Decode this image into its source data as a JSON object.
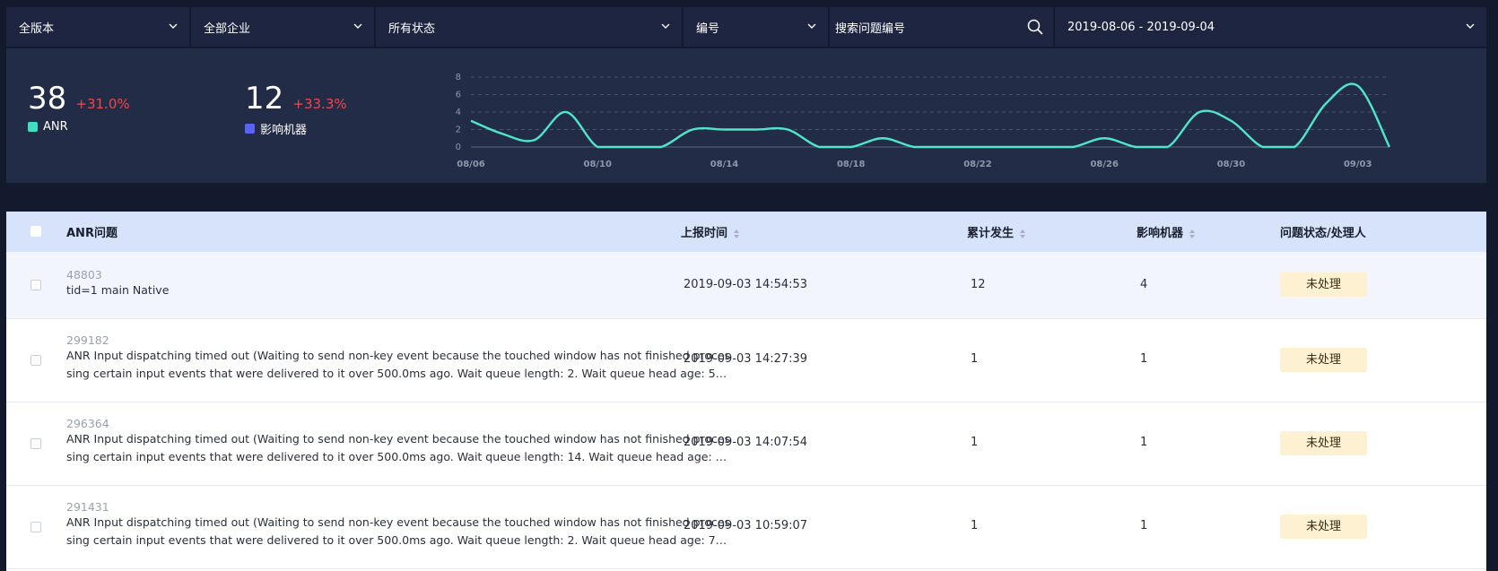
{
  "filters": {
    "version": "全版本",
    "company": "全部企业",
    "status": "所有状态",
    "id_type": "编号",
    "search_placeholder": "搜索问题编号",
    "date_range": "2019-08-06 - 2019-09-04"
  },
  "stats": {
    "anr": {
      "value": "38",
      "change": "+31.0%",
      "label": "ANR",
      "color": "#3de0c0"
    },
    "devices": {
      "value": "12",
      "change": "+33.3%",
      "label": "影响机器",
      "color": "#5b63f5"
    }
  },
  "colors": {
    "accent": "#4fe6c8",
    "negative": "#f0474b",
    "header_bg": "#d6e3fb",
    "badge_bg": "#fdf1d2"
  },
  "chart_data": {
    "type": "line",
    "x": [
      "08/06",
      "08/07",
      "08/08",
      "08/09",
      "08/10",
      "08/11",
      "08/12",
      "08/13",
      "08/14",
      "08/15",
      "08/16",
      "08/17",
      "08/18",
      "08/19",
      "08/20",
      "08/21",
      "08/22",
      "08/23",
      "08/24",
      "08/25",
      "08/26",
      "08/27",
      "08/28",
      "08/29",
      "08/30",
      "08/31",
      "09/01",
      "09/02",
      "09/03",
      "09/04"
    ],
    "series": [
      {
        "values": [
          3,
          1.5,
          0.8,
          4,
          0,
          0,
          0,
          2,
          2,
          2,
          2,
          0,
          0,
          1,
          0,
          0,
          0,
          0,
          0,
          0,
          1,
          0,
          0,
          4,
          3,
          0,
          0,
          5,
          7,
          0
        ]
      }
    ],
    "xticks": [
      "08/06",
      "08/10",
      "08/14",
      "08/18",
      "08/22",
      "08/26",
      "08/30",
      "09/03"
    ],
    "yticks": [
      0,
      2,
      4,
      6,
      8
    ],
    "ylim": [
      0,
      8
    ],
    "grid": true
  },
  "table": {
    "headers": {
      "issue": "ANR问题",
      "time": "上报时间",
      "count": "累计发生",
      "devices": "影响机器",
      "status": "问题状态/处理人"
    },
    "rows": [
      {
        "id": "48803",
        "title_line1": "tid=1 main Native",
        "title_line2": "",
        "time": "2019-09-03 14:54:53",
        "count": "12",
        "devices": "4",
        "status": "未处理"
      },
      {
        "id": "299182",
        "title_line1": "ANR Input dispatching timed out (Waiting to send non-key event because the touched window has not finished proces",
        "title_line2": "sing certain input events that were delivered to it over 500.0ms ago. Wait queue length: 2. Wait queue head age: 5…",
        "time": "2019-09-03 14:27:39",
        "count": "1",
        "devices": "1",
        "status": "未处理"
      },
      {
        "id": "296364",
        "title_line1": "ANR Input dispatching timed out (Waiting to send non-key event because the touched window has not finished proces",
        "title_line2": "sing certain input events that were delivered to it over 500.0ms ago. Wait queue length: 14. Wait queue head age: …",
        "time": "2019-09-03 14:07:54",
        "count": "1",
        "devices": "1",
        "status": "未处理"
      },
      {
        "id": "291431",
        "title_line1": "ANR Input dispatching timed out (Waiting to send non-key event because the touched window has not finished proces",
        "title_line2": "sing certain input events that were delivered to it over 500.0ms ago. Wait queue length: 2. Wait queue head age: 7…",
        "time": "2019-09-03 10:59:07",
        "count": "1",
        "devices": "1",
        "status": "未处理"
      }
    ]
  }
}
